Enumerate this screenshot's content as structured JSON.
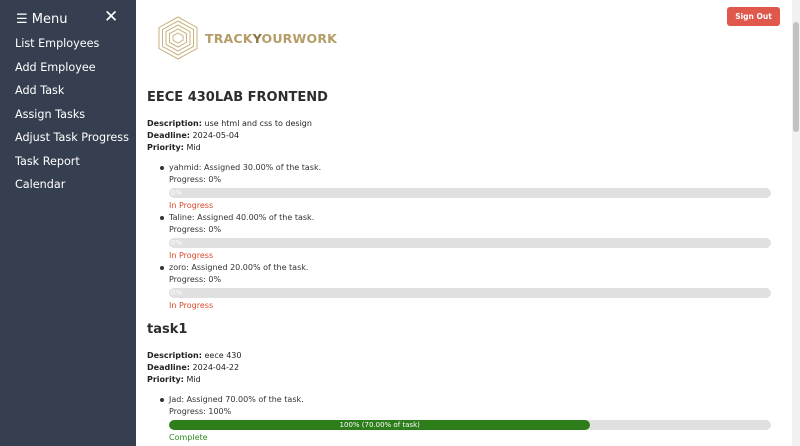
{
  "sidebar": {
    "menu_label": "☰ Menu",
    "close_glyph": "✕",
    "items": [
      {
        "label": "List Employees"
      },
      {
        "label": "Add Employee"
      },
      {
        "label": "Add Task"
      },
      {
        "label": "Assign Tasks"
      },
      {
        "label": "Adjust Task Progress"
      },
      {
        "label": "Task Report"
      },
      {
        "label": "Calendar"
      }
    ]
  },
  "header": {
    "sign_out_label": "Sign Out",
    "logo_text_1": "TRACK",
    "logo_text_2": "Y",
    "logo_text_3": "OURWORK"
  },
  "tasks": [
    {
      "title": "EECE 430LAB FRONTEND",
      "description_label": "Description:",
      "description": "use html and css to design",
      "deadline_label": "Deadline:",
      "deadline": "2024-05-04",
      "priority_label": "Priority:",
      "priority": "Mid",
      "assignees": [
        {
          "line": "yahmid: Assigned 30.00% of the task.",
          "progress_text": "Progress: 0%",
          "progress": 0,
          "bar_label": "0%",
          "status": "In Progress"
        },
        {
          "line": "Taline: Assigned 40.00% of the task.",
          "progress_text": "Progress: 0%",
          "progress": 0,
          "bar_label": "0%",
          "status": "In Progress"
        },
        {
          "line": "zoro: Assigned 20.00% of the task.",
          "progress_text": "Progress: 0%",
          "progress": 0,
          "bar_label": "0%",
          "status": "In Progress"
        }
      ]
    },
    {
      "title": "task1",
      "description_label": "Description:",
      "description": "eece 430",
      "deadline_label": "Deadline:",
      "deadline": "2024-04-22",
      "priority_label": "Priority:",
      "priority": "Mid",
      "assignees": [
        {
          "line": "Jad: Assigned 70.00% of the task.",
          "progress_text": "Progress: 100%",
          "progress": 0.7,
          "bar_label": "100% (70.00% of task)",
          "status": "Complete"
        }
      ]
    }
  ],
  "colors": {
    "sidebar_bg": "#353f50",
    "sign_out": "#e0574b",
    "in_progress": "#d9482b",
    "complete": "#2f8a1f",
    "bar_fill_complete": "#2e7d1b",
    "bar_bg": "#e0e0e0",
    "logo_gold": "#b59d68"
  },
  "icons": {
    "menu": "hamburger-icon",
    "close": "close-icon",
    "logo": "hexagon-logo-icon",
    "bullet": "bullet-icon"
  }
}
